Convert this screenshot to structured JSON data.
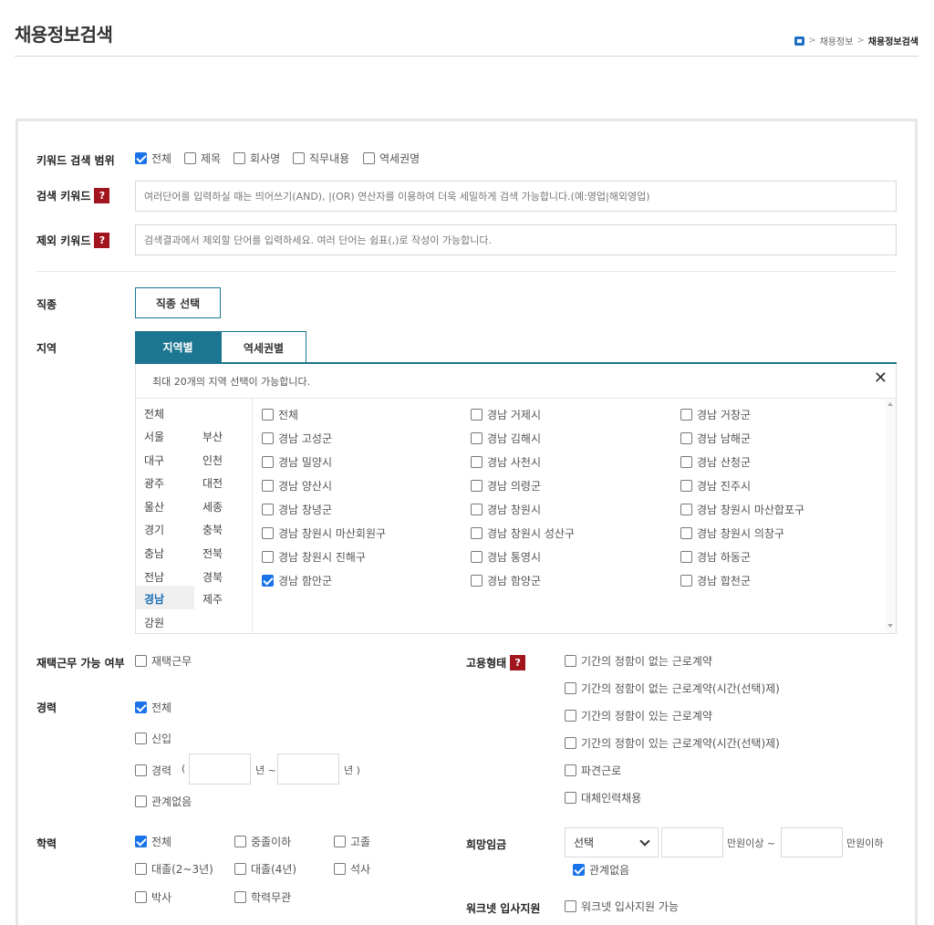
{
  "header": {
    "title": "채용정보검색",
    "breadcrumb": [
      "채용정보",
      "채용정보검색"
    ],
    "breadcrumb_sep": ">"
  },
  "keyword_scope": {
    "label": "키워드 검색 범위",
    "options": [
      {
        "label": "전체",
        "checked": true
      },
      {
        "label": "제목",
        "checked": false
      },
      {
        "label": "회사명",
        "checked": false
      },
      {
        "label": "직무내용",
        "checked": false
      },
      {
        "label": "역세권명",
        "checked": false
      }
    ]
  },
  "search_keyword": {
    "label": "검색 키워드",
    "help": "?",
    "placeholder": "여러단어를 입력하실 때는 띄어쓰기(AND), |(OR) 연산자를 이용하여 더욱 세밀하게 검색 가능합니다.(예:영업|해외영업)"
  },
  "exclude_keyword": {
    "label": "제외 키워드",
    "help": "?",
    "placeholder": "검색결과에서 제외할 단어를 입력하세요. 여러 단어는 쉼표(,)로 작성이 가능합니다."
  },
  "job_type": {
    "label": "직종",
    "button": "직종 선택"
  },
  "region": {
    "label": "지역",
    "tabs": [
      "지역별",
      "역세권별"
    ],
    "notice": "최대 20개의 지역 선택이 가능합니다.",
    "close": "✕",
    "provinces": [
      "전체",
      "서울",
      "부산",
      "대구",
      "인천",
      "광주",
      "대전",
      "울산",
      "세종",
      "경기",
      "충북",
      "충남",
      "전북",
      "전남",
      "경북",
      "경남",
      "제주",
      "강원"
    ],
    "selected_province": "경남",
    "districts": [
      {
        "label": "전체",
        "checked": false
      },
      {
        "label": "경남 거제시",
        "checked": false
      },
      {
        "label": "경남 거창군",
        "checked": false
      },
      {
        "label": "경남 고성군",
        "checked": false
      },
      {
        "label": "경남 김해시",
        "checked": false
      },
      {
        "label": "경남 남해군",
        "checked": false
      },
      {
        "label": "경남 밀양시",
        "checked": false
      },
      {
        "label": "경남 사천시",
        "checked": false
      },
      {
        "label": "경남 산청군",
        "checked": false
      },
      {
        "label": "경남 양산시",
        "checked": false
      },
      {
        "label": "경남 의령군",
        "checked": false
      },
      {
        "label": "경남 진주시",
        "checked": false
      },
      {
        "label": "경남 창녕군",
        "checked": false
      },
      {
        "label": "경남 창원시",
        "checked": false
      },
      {
        "label": "경남 창원시 마산합포구",
        "checked": false
      },
      {
        "label": "경남 창원시 마산회원구",
        "checked": false
      },
      {
        "label": "경남 창원시 성산구",
        "checked": false
      },
      {
        "label": "경남 창원시 의창구",
        "checked": false
      },
      {
        "label": "경남 창원시 진해구",
        "checked": false
      },
      {
        "label": "경남 통영시",
        "checked": false
      },
      {
        "label": "경남 하동군",
        "checked": false
      },
      {
        "label": "경남 함안군",
        "checked": true
      },
      {
        "label": "경남 함양군",
        "checked": false
      },
      {
        "label": "경남 합천군",
        "checked": false
      }
    ]
  },
  "remote": {
    "label": "재택근무 가능 여부",
    "option": "재택근무",
    "checked": false
  },
  "career": {
    "label": "경력",
    "options": [
      {
        "label": "전체",
        "checked": true
      },
      {
        "label": "신입",
        "checked": false
      },
      {
        "label": "경력",
        "checked": false
      },
      {
        "label": "관계없음",
        "checked": false
      }
    ],
    "range_open": "(",
    "year_from": "년 ~",
    "year_to": "년 )"
  },
  "education": {
    "label": "학력",
    "options": [
      {
        "label": "전체",
        "checked": true
      },
      {
        "label": "중졸이하",
        "checked": false
      },
      {
        "label": "고졸",
        "checked": false
      },
      {
        "label": "대졸(2~3년)",
        "checked": false
      },
      {
        "label": "대졸(4년)",
        "checked": false
      },
      {
        "label": "석사",
        "checked": false
      },
      {
        "label": "박사",
        "checked": false
      },
      {
        "label": "학력무관",
        "checked": false
      }
    ]
  },
  "employment_type": {
    "label": "고용형태",
    "help": "?",
    "options": [
      {
        "label": "기간의 정함이 없는 근로계약",
        "checked": false
      },
      {
        "label": "기간의 정함이 없는 근로계약(시간(선택)제)",
        "checked": false
      },
      {
        "label": "기간의 정함이 있는 근로계약",
        "checked": false
      },
      {
        "label": "기간의 정함이 있는 근로계약(시간(선택)제)",
        "checked": false
      },
      {
        "label": "파견근로",
        "checked": false
      },
      {
        "label": "대체인력채용",
        "checked": false
      }
    ]
  },
  "salary": {
    "label": "희망임금",
    "select_value": "선택",
    "min_unit": "만원이상 ~",
    "max_unit": "만원이하",
    "no_matter": {
      "label": "관계없음",
      "checked": true
    }
  },
  "worknet": {
    "label": "워크넷 입사지원",
    "option": "워크넷 입사지원 가능",
    "checked": false
  },
  "colors": {
    "accent": "#1c7591",
    "check": "#1a73e8",
    "help": "#a3151e"
  }
}
